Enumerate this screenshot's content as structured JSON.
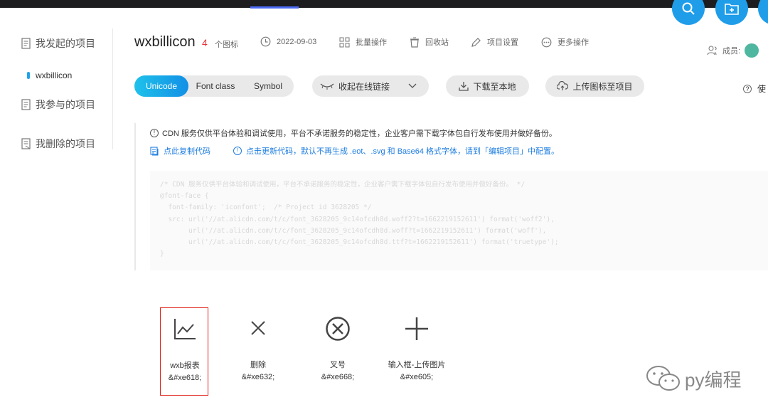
{
  "sidebar": {
    "items": [
      {
        "label": "我发起的项目"
      },
      {
        "label": "我参与的项目"
      },
      {
        "label": "我删除的项目"
      }
    ],
    "active_project": "wxbillicon"
  },
  "project": {
    "title": "wxbillicon",
    "icon_count": "4",
    "icon_count_unit": "个图标",
    "date": "2022-09-03",
    "actions": [
      "批量操作",
      "回收站",
      "项目设置",
      "更多操作"
    ]
  },
  "members": {
    "label": "成员:"
  },
  "format_tabs": [
    {
      "label": "Unicode",
      "active": true
    },
    {
      "label": "Font class",
      "active": false
    },
    {
      "label": "Symbol",
      "active": false
    }
  ],
  "toolbar": {
    "collapse_link": "收起在线链接",
    "download": "下载至本地",
    "upload": "上传图标至项目",
    "help": "使"
  },
  "notice": {
    "text": "CDN 服务仅供平台体验和调试使用，平台不承诺服务的稳定性，企业客户需下载字体包自行发布使用并做好备份。",
    "copy_link": "点此复制代码",
    "update_link": "点击更新代码，默认不再生成 .eot、.svg 和 Base64 格式字体，请到「编辑项目」中配置。"
  },
  "code_lines": [
    "/* CDN 服务仅供平台体验和调试使用，平台不承诺服务的稳定性，企业客户需下载字体包自行发布使用并做好备份。 */",
    "@font-face {",
    "  font-family: 'iconfont';  /* Project id 3628205 */",
    "  src: url('//at.alicdn.com/t/c/font_3628205_9c14ofcdh8d.woff2?t=1662219152611') format('woff2'),",
    "       url('//at.alicdn.com/t/c/font_3628205_9c14ofcdh8d.woff?t=1662219152611') format('woff'),",
    "       url('//at.alicdn.com/t/c/font_3628205_9c14ofcdh8d.ttf?t=1662219152611') format('truetype');",
    "}"
  ],
  "glyphs": [
    {
      "name": "wxb报表",
      "code": "&#xe618;",
      "icon": "line-chart-icon",
      "selected": true
    },
    {
      "name": "删除",
      "code": "&#xe632;",
      "icon": "close-icon",
      "selected": false
    },
    {
      "name": "叉号",
      "code": "&#xe668;",
      "icon": "circle-close-icon",
      "selected": false
    },
    {
      "name": "输入框-上传图片",
      "code": "&#xe605;",
      "icon": "plus-icon",
      "selected": false
    }
  ],
  "watermark": "py编程",
  "colors": {
    "accent": "#1f9de9",
    "count": "#e6353a",
    "link": "#1f7ee0",
    "selected_border": "#e0221a"
  }
}
